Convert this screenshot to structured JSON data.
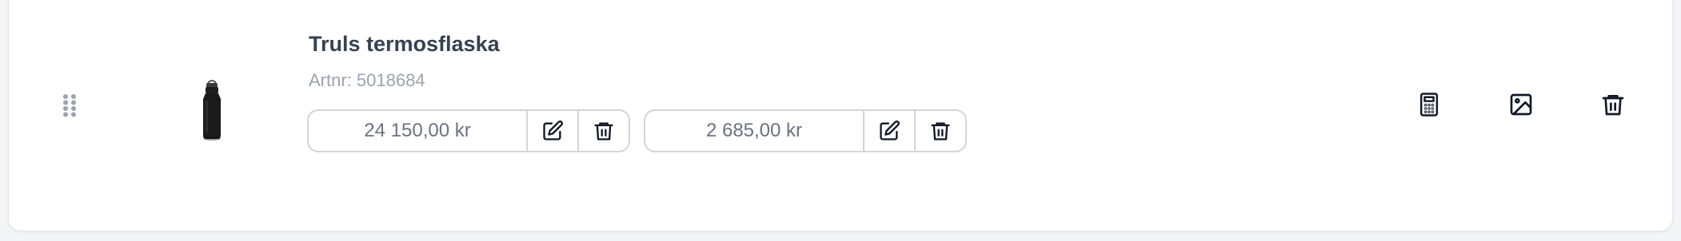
{
  "product": {
    "name": "Truls termosflaska",
    "artnr": "Artnr: 5018684",
    "image_icon": "thermos-bottle-image"
  },
  "prices": [
    {
      "value": "24 150,00 kr",
      "edit_icon": "edit-icon",
      "delete_icon": "trash-icon"
    },
    {
      "value": "2 685,00 kr",
      "edit_icon": "edit-icon",
      "delete_icon": "trash-icon"
    }
  ],
  "actions": {
    "calculator_icon": "calculator-icon",
    "image_icon": "image-icon",
    "delete_icon": "trash-icon"
  },
  "colors": {
    "title": "#374151",
    "muted": "#9ca3af",
    "border": "#d1d5db",
    "icon": "#111827",
    "handle": "#9ca3af"
  }
}
